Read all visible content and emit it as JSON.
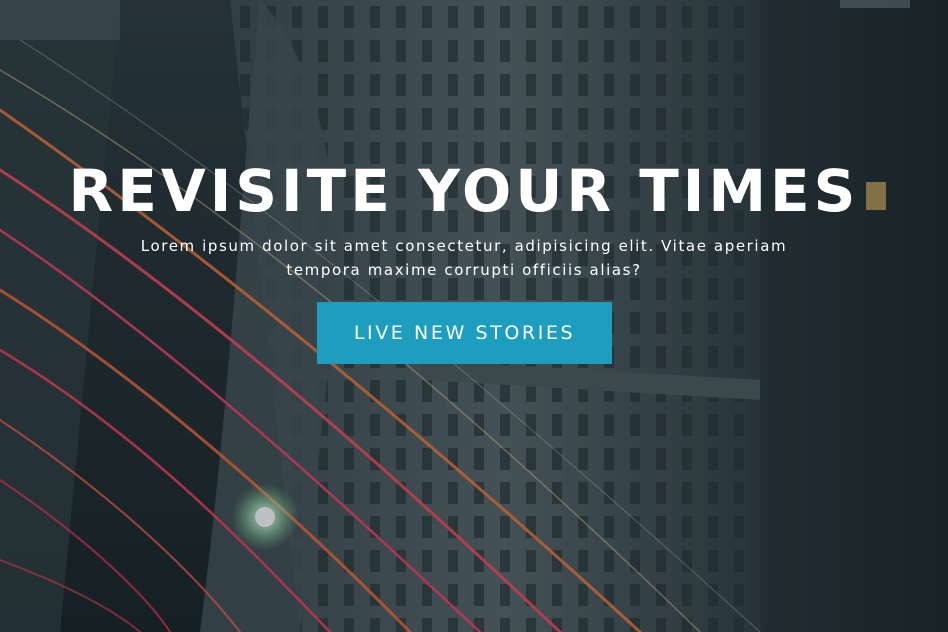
{
  "hero": {
    "title": "REVISITE YOUR TIMES",
    "subtitle": "Lorem ipsum dolor sit amet consectetur, adipisicing elit. Vitae aperiam tempora maxime corrupti officiis alias?",
    "cta_label": "LIVE NEW STORIES"
  },
  "colors": {
    "accent": "#1e9ebe",
    "text": "#ffffff"
  }
}
